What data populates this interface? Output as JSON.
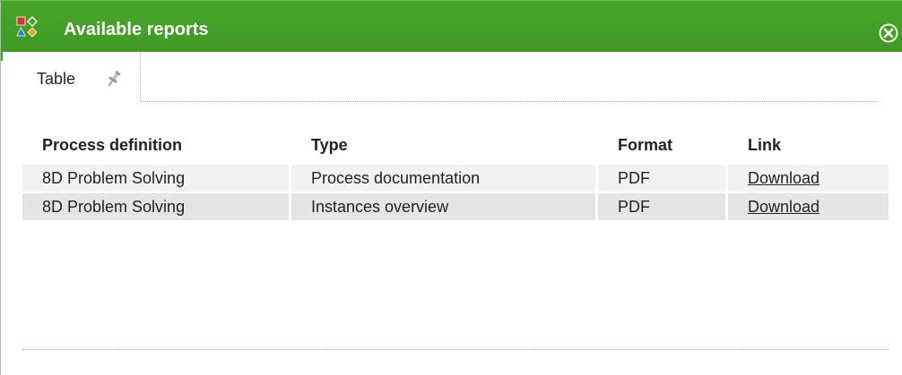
{
  "dialog": {
    "title": "Available reports",
    "title_bar_color": "#3e9a24",
    "icon": "process-shapes-icon",
    "close_icon": "close-circle-icon"
  },
  "tabs": [
    {
      "label": "Table",
      "icon": "pin-icon",
      "active": true
    }
  ],
  "table": {
    "columns": [
      "Process definition",
      "Type",
      "Format",
      "Link"
    ],
    "rows": [
      {
        "process_definition": "8D Problem Solving",
        "type": "Process documentation",
        "format": "PDF",
        "link": "Download"
      },
      {
        "process_definition": "8D Problem Solving",
        "type": "Instances overview",
        "format": "PDF",
        "link": "Download"
      }
    ]
  }
}
